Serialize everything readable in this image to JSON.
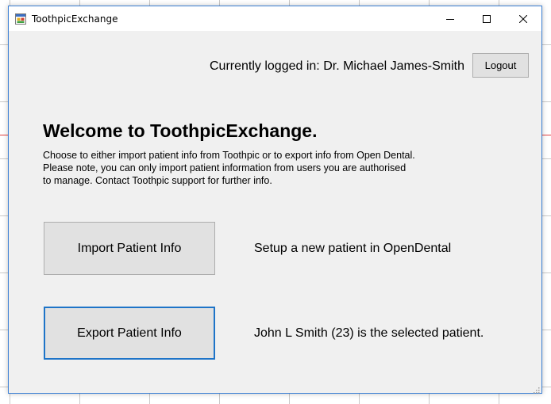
{
  "window": {
    "title": "ToothpicExchange",
    "icons": {
      "app": "app-window-icon",
      "minimize": "minimize-icon",
      "maximize": "maximize-icon",
      "close": "close-icon",
      "grip": "resize-grip-icon"
    }
  },
  "header": {
    "logged_in_text": "Currently logged in: Dr. Michael James-Smith",
    "logout_label": "Logout"
  },
  "main": {
    "welcome_title": "Welcome to ToothpicExchange.",
    "description": "Choose to either import patient info from Toothpic or to export info from Open Dental. Please note, you can only import patient information from users you are authorised to manage. Contact Toothpic support for further info.",
    "import_button_label": "Import Patient Info",
    "import_status": "Setup a new patient in OpenDental",
    "export_button_label": "Export Patient Info",
    "export_status": "John L Smith (23) is the selected patient."
  },
  "colors": {
    "window_bg": "#f0f0f0",
    "focus_border": "#1e74c8",
    "button_bg": "#e1e1e1"
  }
}
